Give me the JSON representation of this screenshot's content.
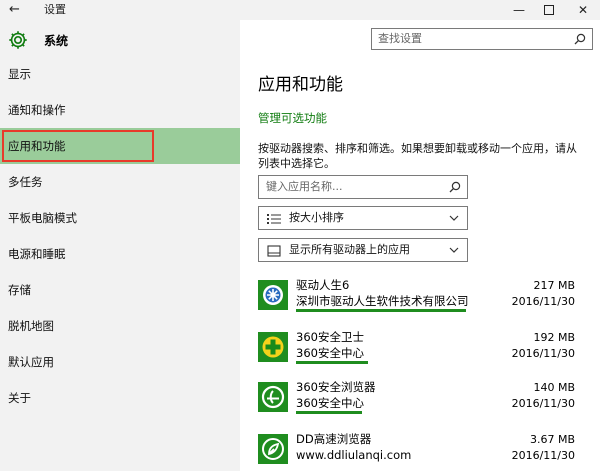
{
  "window": {
    "title": "设置",
    "controls": [
      "minimize",
      "maximize",
      "close"
    ]
  },
  "sidebar": {
    "title": "系统",
    "items": [
      {
        "label": "显示"
      },
      {
        "label": "通知和操作"
      },
      {
        "label": "应用和功能",
        "active": true
      },
      {
        "label": "多任务"
      },
      {
        "label": "平板电脑模式"
      },
      {
        "label": "电源和睡眠"
      },
      {
        "label": "存储"
      },
      {
        "label": "脱机地图"
      },
      {
        "label": "默认应用"
      },
      {
        "label": "关于"
      }
    ]
  },
  "search": {
    "placeholder": "查找设置"
  },
  "main": {
    "heading": "应用和功能",
    "optional_features_link": "管理可选功能",
    "description": "按驱动器搜索、排序和筛选。如果想要卸载或移动一个应用，请从列表中选择它。",
    "app_search_placeholder": "键入应用名称...",
    "sort_label": "按大小排序",
    "filter_label": "显示所有驱动器上的应用",
    "apps": [
      {
        "name": "驱动人生6",
        "publisher": "深圳市驱动人生软件技术有限公司",
        "size": "217 MB",
        "date": "2016/11/30",
        "icon": "gear-app-icon"
      },
      {
        "name": "360安全卫士",
        "publisher": "360安全中心",
        "size": "192 MB",
        "date": "2016/11/30",
        "icon": "plus-app-icon"
      },
      {
        "name": "360安全浏览器",
        "publisher": "360安全中心",
        "size": "140 MB",
        "date": "2016/11/30",
        "icon": "browser-app-icon"
      },
      {
        "name": "DD高速浏览器",
        "publisher": "www.ddliulanqi.com",
        "size": "3.67 MB",
        "date": "2016/11/30",
        "icon": "leaf-app-icon"
      }
    ]
  },
  "colors": {
    "accent": "#107c10",
    "active_nav": "#9acc9a",
    "highlight": "#e83a2a",
    "icon_bg": "#1f8d1f"
  }
}
